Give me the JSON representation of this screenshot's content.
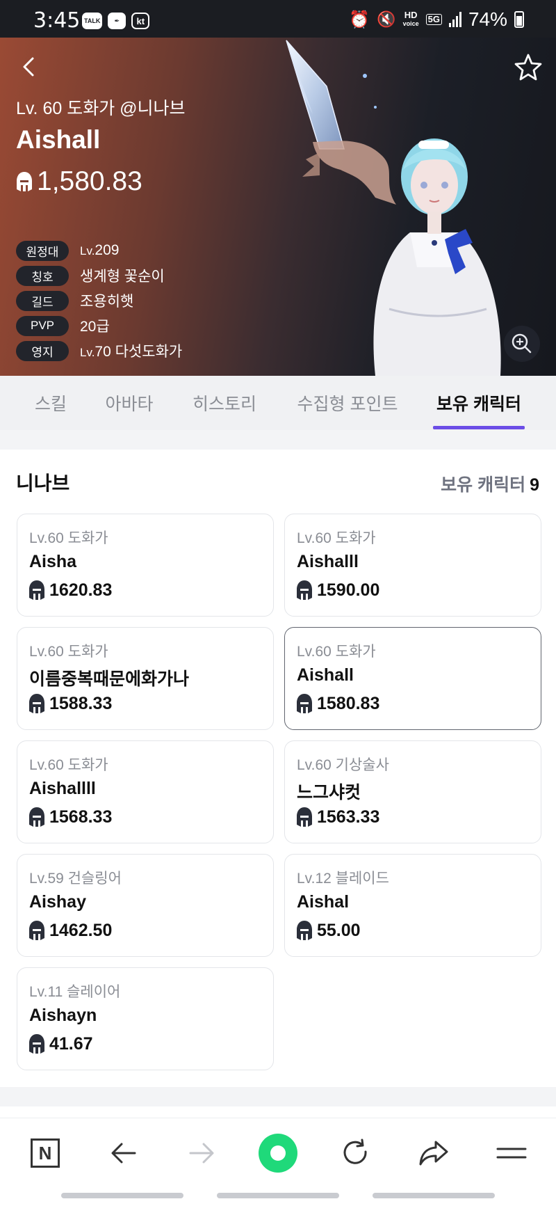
{
  "status_bar": {
    "time": "3:45",
    "left_icons": [
      "talk-icon",
      "feather-icon",
      "kt-icon"
    ],
    "talk_label": "TALK",
    "carrier_label": "kt",
    "hd_label": "HD",
    "voice_label": "voice",
    "network_label": "5G",
    "battery": "74%"
  },
  "hero": {
    "subtitle": "Lv. 60 도화가 @니나브",
    "name": "Aishall",
    "power": "1,580.83",
    "info": [
      {
        "label": "원정대",
        "prefix": "Lv.",
        "value": "209"
      },
      {
        "label": "칭호",
        "prefix": "",
        "value": "생계형 꽃순이"
      },
      {
        "label": "길드",
        "prefix": "",
        "value": "조용히햇"
      },
      {
        "label": "PVP",
        "prefix": "",
        "value": "20급"
      },
      {
        "label": "영지",
        "prefix": "Lv.",
        "value": "70 다섯도화가"
      }
    ]
  },
  "tabs": [
    {
      "label": "스킬",
      "active": false
    },
    {
      "label": "아바타",
      "active": false
    },
    {
      "label": "히스토리",
      "active": false
    },
    {
      "label": "수집형 포인트",
      "active": false
    },
    {
      "label": "보유 캐릭터",
      "active": true
    }
  ],
  "account": {
    "server": "니나브",
    "count_label": "보유 캐릭터",
    "count": "9"
  },
  "characters": [
    {
      "cls": "Lv.60 도화가",
      "name": "Aisha",
      "power": "1620.83",
      "selected": false
    },
    {
      "cls": "Lv.60 도화가",
      "name": "Aishalll",
      "power": "1590.00",
      "selected": false
    },
    {
      "cls": "Lv.60 도화가",
      "name": "이름중복때문에화가나",
      "power": "1588.33",
      "selected": false
    },
    {
      "cls": "Lv.60 도화가",
      "name": "Aishall",
      "power": "1580.83",
      "selected": true
    },
    {
      "cls": "Lv.60 도화가",
      "name": "Aishallll",
      "power": "1568.33",
      "selected": false
    },
    {
      "cls": "Lv.60 기상술사",
      "name": "느그샤컷",
      "power": "1563.33",
      "selected": false
    },
    {
      "cls": "Lv.59 건슬링어",
      "name": "Aishay",
      "power": "1462.50",
      "selected": false
    },
    {
      "cls": "Lv.12 블레이드",
      "name": "Aishal",
      "power": "55.00",
      "selected": false
    },
    {
      "cls": "Lv.11 슬레이어",
      "name": "Aishayn",
      "power": "41.67",
      "selected": false
    }
  ],
  "browser_nav": {
    "logo_letter": "N",
    "buttons": [
      "naver-home-icon",
      "back-arrow-icon",
      "forward-arrow-icon",
      "green-dot-icon",
      "refresh-icon",
      "share-icon",
      "menu-icon"
    ]
  },
  "colors": {
    "accent": "#6b4de6",
    "badge_bg": "#22242b",
    "green_button": "#1fd97a"
  }
}
